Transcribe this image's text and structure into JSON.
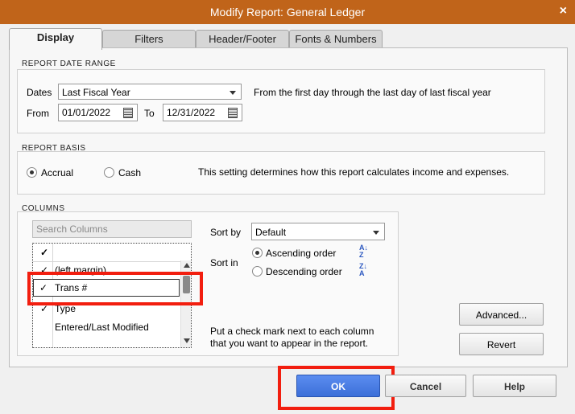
{
  "window": {
    "title": "Modify Report: General Ledger",
    "close_glyph": "×"
  },
  "tabs": [
    "Display",
    "Filters",
    "Header/Footer",
    "Fonts & Numbers"
  ],
  "date_range": {
    "section_label": "REPORT DATE RANGE",
    "dates_label": "Dates",
    "dates_value": "Last Fiscal Year",
    "description": "From the first day through the last day of last fiscal year",
    "from_label": "From",
    "from_value": "01/01/2022",
    "to_label": "To",
    "to_value": "12/31/2022"
  },
  "report_basis": {
    "section_label": "REPORT BASIS",
    "accrual_label": "Accrual",
    "cash_label": "Cash",
    "selected": "Accrual",
    "description": "This setting determines how this report calculates income and expenses."
  },
  "columns": {
    "section_label": "COLUMNS",
    "search_placeholder": "Search Columns",
    "header_check": "✓",
    "items": [
      {
        "checked": true,
        "check": "✓",
        "label": "(left margin)"
      },
      {
        "checked": true,
        "check": "✓",
        "label": "Trans #"
      },
      {
        "checked": true,
        "check": "✓",
        "label": "Type"
      },
      {
        "checked": false,
        "check": "",
        "label": "Entered/Last Modified"
      }
    ],
    "sort_by_label": "Sort by",
    "sort_by_value": "Default",
    "sort_in_label": "Sort in",
    "ascending_label": "Ascending order",
    "descending_label": "Descending order",
    "sort_selected": "Ascending order",
    "help_text_1": "Put a check mark next to each column",
    "help_text_2": "that you want to appear in the report."
  },
  "buttons": {
    "advanced": "Advanced...",
    "revert": "Revert",
    "ok": "OK",
    "cancel": "Cancel",
    "help": "Help"
  },
  "colors": {
    "titlebar": "#c0641a",
    "highlight": "#f21e0f",
    "ok_button": "#3c6fd8"
  }
}
